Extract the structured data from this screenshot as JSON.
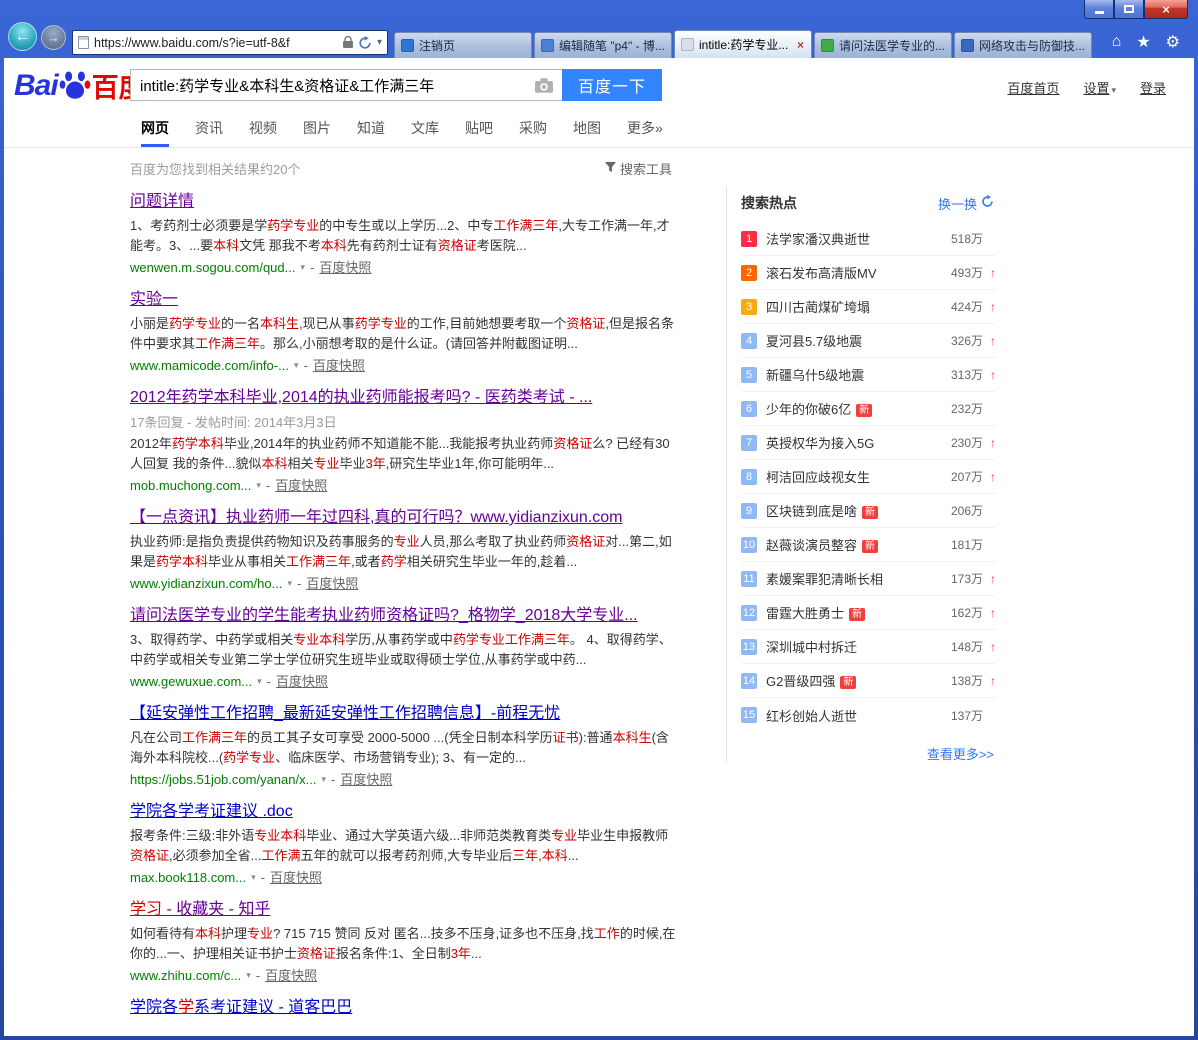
{
  "icons": {
    "back": "←",
    "forward": "→",
    "close": "×",
    "caret": "▾",
    "up": "↑",
    "home": "⌂",
    "favorites": "★",
    "settings": "⚙",
    "settings_caret": "▾"
  },
  "browser": {
    "url": "https://www.baidu.com/s?ie=utf-8&f",
    "tabs": [
      {
        "label": "注销页",
        "icon_color": "#2d77d2",
        "active": false
      },
      {
        "label": "编辑随笔 \"p4\" - 博...",
        "icon_color": "#4a7fd4",
        "active": false
      },
      {
        "label": "intitle:药学专业...",
        "icon_color": "#d7dfeb",
        "active": true
      },
      {
        "label": "请问法医学专业的...",
        "icon_color": "#3fae49",
        "active": false
      },
      {
        "label": "网络攻击与防御技...",
        "icon_color": "#3a67c0",
        "active": false
      }
    ]
  },
  "header": {
    "logo_bai": "Bai",
    "logo_cn": "百度",
    "search_value": "intitle:药学专业&本科生&资格证&工作满三年",
    "search_button": "百度一下",
    "links": [
      "百度首页",
      "设置",
      "登录"
    ]
  },
  "nav": {
    "items": [
      {
        "label": "网页",
        "active": true
      },
      {
        "label": "资讯"
      },
      {
        "label": "视频"
      },
      {
        "label": "图片"
      },
      {
        "label": "知道"
      },
      {
        "label": "文库"
      },
      {
        "label": "贴吧"
      },
      {
        "label": "采购"
      },
      {
        "label": "地图"
      },
      {
        "label": "更多»"
      }
    ]
  },
  "meta": {
    "count": "百度为您找到相关结果约20个",
    "tools": "搜索工具"
  },
  "labels": {
    "snapshot": "百度快照",
    "new_badge": "新"
  },
  "results": [
    {
      "visited": true,
      "title": [
        {
          "t": "问题详情"
        }
      ],
      "desc": [
        {
          "t": "1、考药剂士必须要是学"
        },
        {
          "t": "药学专业",
          "h": true
        },
        {
          "t": "的中专生或以上学历...2、中专"
        },
        {
          "t": "工作满三年",
          "h": true
        },
        {
          "t": ",大专工作满一年,才能考。3、...要"
        },
        {
          "t": "本科",
          "h": true
        },
        {
          "t": "文凭 那我不考"
        },
        {
          "t": "本科",
          "h": true
        },
        {
          "t": "先有药剂士证有"
        },
        {
          "t": "资格证",
          "h": true
        },
        {
          "t": "考医院..."
        }
      ],
      "url": "wenwen.m.sogou.com/qud..."
    },
    {
      "visited": true,
      "title": [
        {
          "t": "实验一"
        }
      ],
      "desc": [
        {
          "t": "小丽是"
        },
        {
          "t": "药学专业",
          "h": true
        },
        {
          "t": "的一名"
        },
        {
          "t": "本科生",
          "h": true
        },
        {
          "t": ",现已从事"
        },
        {
          "t": "药学专业",
          "h": true
        },
        {
          "t": "的工作,目前她想要考取一个"
        },
        {
          "t": "资格证",
          "h": true
        },
        {
          "t": ",但是报名条件中要求其"
        },
        {
          "t": "工作满三年",
          "h": true
        },
        {
          "t": "。那么,小丽想考取的是什么证。(请回答并附截图证明..."
        }
      ],
      "url": "www.mamicode.com/info-..."
    },
    {
      "visited": true,
      "title": [
        {
          "t": "2012年药学本科毕业,2014的执业药师能报考吗? - 医药类考试 - ..."
        }
      ],
      "meta": "17条回复 - 发帖时间: 2014年3月3日",
      "desc": [
        {
          "t": "2012年"
        },
        {
          "t": "药学本科",
          "h": true
        },
        {
          "t": "毕业,2014年的执业药师不知道能不能...我能报考执业药师"
        },
        {
          "t": "资格证",
          "h": true
        },
        {
          "t": "么? 已经有30人回复 我的条件...貌似"
        },
        {
          "t": "本科",
          "h": true
        },
        {
          "t": "相关"
        },
        {
          "t": "专业",
          "h": true
        },
        {
          "t": "毕业"
        },
        {
          "t": "3年",
          "h": true
        },
        {
          "t": ",研究生毕业1年,你可能明年..."
        }
      ],
      "url": "mob.muchong.com..."
    },
    {
      "visited": true,
      "title": [
        {
          "t": "【一点资讯】执业药师一年过四科,真的可行吗？www.yidianzixun.com"
        }
      ],
      "desc": [
        {
          "t": "执业药师:是指负责提供药物知识及药事服务的"
        },
        {
          "t": "专业",
          "h": true
        },
        {
          "t": "人员,那么考取了执业药师"
        },
        {
          "t": "资格证",
          "h": true
        },
        {
          "t": "对...第二,如果是"
        },
        {
          "t": "药学本科",
          "h": true
        },
        {
          "t": "毕业从事相关"
        },
        {
          "t": "工作满三年",
          "h": true
        },
        {
          "t": ",或者"
        },
        {
          "t": "药学",
          "h": true
        },
        {
          "t": "相关研究生毕业一年的,趁着..."
        }
      ],
      "url": "www.yidianzixun.com/ho..."
    },
    {
      "visited": true,
      "title": [
        {
          "t": "请问法医学专业的学生能考执业药师资格证吗?_格物学_2018大学专业..."
        }
      ],
      "desc": [
        {
          "t": "3、取得药学、中药学或相关"
        },
        {
          "t": "专业本科",
          "h": true
        },
        {
          "t": "学历,从事药学或中"
        },
        {
          "t": "药学专业",
          "h": true
        },
        {
          "t": "工作满三年",
          "h": true
        },
        {
          "t": "。 4、取得药学、中药学或相关专业第二学士学位研究生班毕业或取得硕士学位,从事药学或中药..."
        }
      ],
      "url": "www.gewuxue.com..."
    },
    {
      "visited": false,
      "title": [
        {
          "t": "【延安弹性工作招聘_最新延安弹性工作招聘信息】-前程无忧"
        }
      ],
      "desc": [
        {
          "t": "凡在公司"
        },
        {
          "t": "工作满三年",
          "h": true
        },
        {
          "t": "的员工其子女可享受 2000-5000 ...(凭全日制本科学历"
        },
        {
          "t": "证书",
          "h": true
        },
        {
          "t": "):普通"
        },
        {
          "t": "本科生",
          "h": true
        },
        {
          "t": "(含海外本科院校...("
        },
        {
          "t": "药学专业",
          "h": true
        },
        {
          "t": "、临床医学、市场营销专业); 3、有一定的..."
        }
      ],
      "url": "https://jobs.51job.com/yanan/x..."
    },
    {
      "visited": false,
      "title": [
        {
          "t": "学院各学考证建议 .doc"
        }
      ],
      "desc": [
        {
          "t": "报考条件:三级:非外语"
        },
        {
          "t": "专业本科",
          "h": true
        },
        {
          "t": "毕业、通过大学英语六级...非师范类教育类"
        },
        {
          "t": "专业",
          "h": true
        },
        {
          "t": "毕业生申报教师"
        },
        {
          "t": "资格证",
          "h": true
        },
        {
          "t": ",必须参加全省..."
        },
        {
          "t": "工作满",
          "h": true
        },
        {
          "t": "五年的就可以报考药剂师,大专毕业后"
        },
        {
          "t": "三年,本科",
          "h": true
        },
        {
          "t": "..."
        }
      ],
      "url": "max.book118.com..."
    },
    {
      "visited": true,
      "title": [
        {
          "t": "学习",
          "h": true
        },
        {
          "t": " - 收藏夹 - 知乎"
        }
      ],
      "desc": [
        {
          "t": "如何看待有"
        },
        {
          "t": "本科",
          "h": true
        },
        {
          "t": "护理"
        },
        {
          "t": "专业",
          "h": true
        },
        {
          "t": "? 715 715 赞同 反对 匿名...技多不压身,证多也不压身,找"
        },
        {
          "t": "工作",
          "h": true
        },
        {
          "t": "的时候,在你的...一、护理相关证书护士"
        },
        {
          "t": "资格证",
          "h": true
        },
        {
          "t": "报名条件:1、全日制"
        },
        {
          "t": "3年",
          "h": true
        },
        {
          "t": "..."
        }
      ],
      "url": "www.zhihu.com/c..."
    },
    {
      "visited": false,
      "title": [
        {
          "t": "学院各"
        },
        {
          "t": "学",
          "h": true
        },
        {
          "t": "系考证建议 - 道客巴巴"
        }
      ]
    }
  ],
  "hot": {
    "title": "搜索热点",
    "refresh": "换一换",
    "more": "查看更多>>",
    "items": [
      {
        "rank": 1,
        "label": "法学家潘汉典逝世",
        "count": "518万",
        "up": false,
        "new": false
      },
      {
        "rank": 2,
        "label": "滚石发布高清版MV",
        "count": "493万",
        "up": true,
        "new": false
      },
      {
        "rank": 3,
        "label": "四川古蔺煤矿垮塌",
        "count": "424万",
        "up": true,
        "new": false
      },
      {
        "rank": 4,
        "label": "夏河县5.7级地震",
        "count": "326万",
        "up": true,
        "new": false
      },
      {
        "rank": 5,
        "label": "新疆乌什5级地震",
        "count": "313万",
        "up": true,
        "new": false
      },
      {
        "rank": 6,
        "label": "少年的你破6亿",
        "count": "232万",
        "up": false,
        "new": true
      },
      {
        "rank": 7,
        "label": "英授权华为接入5G",
        "count": "230万",
        "up": true,
        "new": false
      },
      {
        "rank": 8,
        "label": "柯洁回应歧视女生",
        "count": "207万",
        "up": true,
        "new": false
      },
      {
        "rank": 9,
        "label": "区块链到底是啥",
        "count": "206万",
        "up": false,
        "new": true
      },
      {
        "rank": 10,
        "label": "赵薇谈演员整容",
        "count": "181万",
        "up": false,
        "new": true
      },
      {
        "rank": 11,
        "label": "素媛案罪犯清晰长相",
        "count": "173万",
        "up": true,
        "new": false
      },
      {
        "rank": 12,
        "label": "雷霆大胜勇士",
        "count": "162万",
        "up": true,
        "new": true
      },
      {
        "rank": 13,
        "label": "深圳城中村拆迁",
        "count": "148万",
        "up": true,
        "new": false
      },
      {
        "rank": 14,
        "label": "G2晋级四强",
        "count": "138万",
        "up": true,
        "new": true
      },
      {
        "rank": 15,
        "label": "红杉创始人逝世",
        "count": "137万",
        "up": false,
        "new": false
      }
    ]
  }
}
